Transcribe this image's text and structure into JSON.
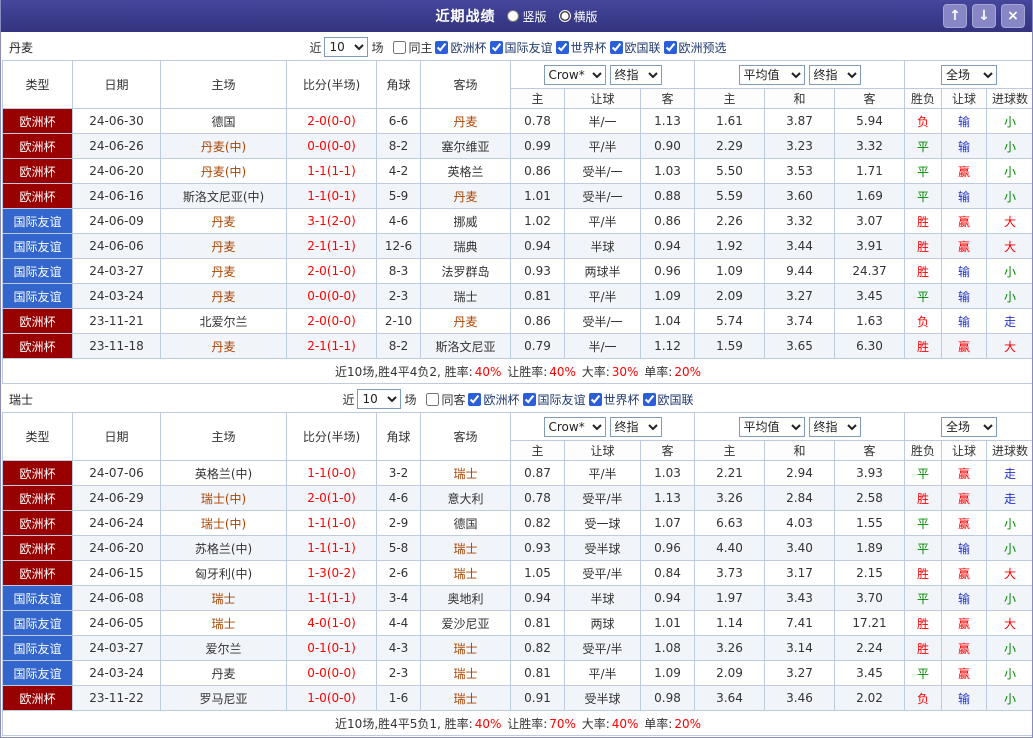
{
  "header": {
    "title": "近期战绩",
    "view_options": [
      {
        "label": "竖版",
        "selected": false
      },
      {
        "label": "横版",
        "selected": true
      }
    ],
    "window_buttons": {
      "up": "↑",
      "down": "↓",
      "close": "×"
    }
  },
  "table_header": {
    "type": "类型",
    "date": "日期",
    "home": "主场",
    "score": "比分(半场)",
    "corner": "角球",
    "away": "客场",
    "group1_selects": [
      "Crow*",
      "终指"
    ],
    "group2_selects": [
      "平均值",
      "终指"
    ],
    "group3_selects": [
      "全场"
    ],
    "sub": [
      "主",
      "让球",
      "客",
      "主",
      "和",
      "客",
      "胜负",
      "让球",
      "进球数"
    ]
  },
  "colors": {
    "competition": {
      "欧洲杯": "#990000",
      "国际友谊": "#3366cc"
    },
    "result": {
      "胜": "#ff0000",
      "平": "#008800",
      "负": "#ff0000",
      "赢": "#ff0000",
      "输": "#2233cc",
      "走": "#2233cc",
      "大": "#ff0000",
      "小": "#008800"
    },
    "focus_team": "#aa4400",
    "score": "#ff0000",
    "percent": "#ff0000"
  },
  "sections": [
    {
      "team": "丹麦",
      "filter": {
        "near_label": "近",
        "count": "10",
        "games_label": "场",
        "venue": {
          "label": "同主",
          "checked": false
        },
        "competitions": [
          {
            "label": "欧洲杯",
            "checked": true
          },
          {
            "label": "国际友谊",
            "checked": true
          },
          {
            "label": "世界杯",
            "checked": true
          },
          {
            "label": "欧国联",
            "checked": true
          },
          {
            "label": "欧洲预选",
            "checked": true
          }
        ]
      },
      "rows": [
        {
          "comp": "欧洲杯",
          "date": "24-06-30",
          "home": "德国",
          "score": "2-0(0-0)",
          "corner": "6-6",
          "away": "丹麦",
          "odds": [
            "0.78",
            "半/一",
            "1.13"
          ],
          "avg": [
            "1.61",
            "3.87",
            "5.94"
          ],
          "res": [
            "负",
            "输",
            "小"
          ]
        },
        {
          "comp": "欧洲杯",
          "date": "24-06-26",
          "home": "丹麦(中)",
          "score": "0-0(0-0)",
          "corner": "8-2",
          "away": "塞尔维亚",
          "odds": [
            "0.99",
            "平/半",
            "0.90"
          ],
          "avg": [
            "2.29",
            "3.23",
            "3.32"
          ],
          "res": [
            "平",
            "输",
            "小"
          ]
        },
        {
          "comp": "欧洲杯",
          "date": "24-06-20",
          "home": "丹麦(中)",
          "score": "1-1(1-1)",
          "corner": "4-2",
          "away": "英格兰",
          "odds": [
            "0.86",
            "受半/一",
            "1.03"
          ],
          "avg": [
            "5.50",
            "3.53",
            "1.71"
          ],
          "res": [
            "平",
            "赢",
            "小"
          ]
        },
        {
          "comp": "欧洲杯",
          "date": "24-06-16",
          "home": "斯洛文尼亚(中)",
          "score": "1-1(0-1)",
          "corner": "5-9",
          "away": "丹麦",
          "odds": [
            "1.01",
            "受半/一",
            "0.88"
          ],
          "avg": [
            "5.59",
            "3.60",
            "1.69"
          ],
          "res": [
            "平",
            "输",
            "小"
          ]
        },
        {
          "comp": "国际友谊",
          "date": "24-06-09",
          "home": "丹麦",
          "score": "3-1(2-0)",
          "corner": "4-6",
          "away": "挪威",
          "odds": [
            "1.02",
            "平/半",
            "0.86"
          ],
          "avg": [
            "2.26",
            "3.32",
            "3.07"
          ],
          "res": [
            "胜",
            "赢",
            "大"
          ]
        },
        {
          "comp": "国际友谊",
          "date": "24-06-06",
          "home": "丹麦",
          "score": "2-1(1-1)",
          "corner": "12-6",
          "away": "瑞典",
          "odds": [
            "0.94",
            "半球",
            "0.94"
          ],
          "avg": [
            "1.92",
            "3.44",
            "3.91"
          ],
          "res": [
            "胜",
            "赢",
            "大"
          ]
        },
        {
          "comp": "国际友谊",
          "date": "24-03-27",
          "home": "丹麦",
          "score": "2-0(1-0)",
          "corner": "8-3",
          "away": "法罗群岛",
          "odds": [
            "0.93",
            "两球半",
            "0.96"
          ],
          "avg": [
            "1.09",
            "9.44",
            "24.37"
          ],
          "res": [
            "胜",
            "输",
            "小"
          ]
        },
        {
          "comp": "国际友谊",
          "date": "24-03-24",
          "home": "丹麦",
          "score": "0-0(0-0)",
          "corner": "2-3",
          "away": "瑞士",
          "odds": [
            "0.81",
            "平/半",
            "1.09"
          ],
          "avg": [
            "2.09",
            "3.27",
            "3.45"
          ],
          "res": [
            "平",
            "输",
            "小"
          ]
        },
        {
          "comp": "欧洲杯",
          "date": "23-11-21",
          "home": "北爱尔兰",
          "score": "2-0(0-0)",
          "corner": "2-10",
          "away": "丹麦",
          "odds": [
            "0.86",
            "受半/一",
            "1.04"
          ],
          "avg": [
            "5.74",
            "3.74",
            "1.63"
          ],
          "res": [
            "负",
            "输",
            "走"
          ]
        },
        {
          "comp": "欧洲杯",
          "date": "23-11-18",
          "home": "丹麦",
          "score": "2-1(1-1)",
          "corner": "8-2",
          "away": "斯洛文尼亚",
          "odds": [
            "0.79",
            "半/一",
            "1.12"
          ],
          "avg": [
            "1.59",
            "3.65",
            "6.30"
          ],
          "res": [
            "胜",
            "赢",
            "大"
          ]
        }
      ],
      "summary": [
        [
          "近10场,胜4平4负2, 胜率:",
          0
        ],
        [
          "40%",
          1
        ],
        [
          " 让胜率:",
          0
        ],
        [
          "40%",
          1
        ],
        [
          " 大率:",
          0
        ],
        [
          "30%",
          1
        ],
        [
          " 单率:",
          0
        ],
        [
          "20%",
          1
        ]
      ]
    },
    {
      "team": "瑞士",
      "filter": {
        "near_label": "近",
        "count": "10",
        "games_label": "场",
        "venue": {
          "label": "同客",
          "checked": false
        },
        "competitions": [
          {
            "label": "欧洲杯",
            "checked": true
          },
          {
            "label": "国际友谊",
            "checked": true
          },
          {
            "label": "世界杯",
            "checked": true
          },
          {
            "label": "欧国联",
            "checked": true
          }
        ]
      },
      "rows": [
        {
          "comp": "欧洲杯",
          "date": "24-07-06",
          "home": "英格兰(中)",
          "score": "1-1(0-0)",
          "corner": "3-2",
          "away": "瑞士",
          "odds": [
            "0.87",
            "平/半",
            "1.03"
          ],
          "avg": [
            "2.21",
            "2.94",
            "3.93"
          ],
          "res": [
            "平",
            "赢",
            "走"
          ]
        },
        {
          "comp": "欧洲杯",
          "date": "24-06-29",
          "home": "瑞士(中)",
          "score": "2-0(1-0)",
          "corner": "4-6",
          "away": "意大利",
          "odds": [
            "0.78",
            "受平/半",
            "1.13"
          ],
          "avg": [
            "3.26",
            "2.84",
            "2.58"
          ],
          "res": [
            "胜",
            "赢",
            "走"
          ]
        },
        {
          "comp": "欧洲杯",
          "date": "24-06-24",
          "home": "瑞士(中)",
          "score": "1-1(1-0)",
          "corner": "2-9",
          "away": "德国",
          "odds": [
            "0.82",
            "受一球",
            "1.07"
          ],
          "avg": [
            "6.63",
            "4.03",
            "1.55"
          ],
          "res": [
            "平",
            "赢",
            "小"
          ]
        },
        {
          "comp": "欧洲杯",
          "date": "24-06-20",
          "home": "苏格兰(中)",
          "score": "1-1(1-1)",
          "corner": "5-8",
          "away": "瑞士",
          "odds": [
            "0.93",
            "受半球",
            "0.96"
          ],
          "avg": [
            "4.40",
            "3.40",
            "1.89"
          ],
          "res": [
            "平",
            "输",
            "小"
          ]
        },
        {
          "comp": "欧洲杯",
          "date": "24-06-15",
          "home": "匈牙利(中)",
          "score": "1-3(0-2)",
          "corner": "2-6",
          "away": "瑞士",
          "odds": [
            "1.05",
            "受平/半",
            "0.84"
          ],
          "avg": [
            "3.73",
            "3.17",
            "2.15"
          ],
          "res": [
            "胜",
            "赢",
            "大"
          ]
        },
        {
          "comp": "国际友谊",
          "date": "24-06-08",
          "home": "瑞士",
          "score": "1-1(1-1)",
          "corner": "3-4",
          "away": "奥地利",
          "odds": [
            "0.94",
            "半球",
            "0.94"
          ],
          "avg": [
            "1.97",
            "3.43",
            "3.70"
          ],
          "res": [
            "平",
            "输",
            "小"
          ]
        },
        {
          "comp": "国际友谊",
          "date": "24-06-05",
          "home": "瑞士",
          "score": "4-0(1-0)",
          "corner": "4-4",
          "away": "爱沙尼亚",
          "odds": [
            "0.81",
            "两球",
            "1.01"
          ],
          "avg": [
            "1.14",
            "7.41",
            "17.21"
          ],
          "res": [
            "胜",
            "赢",
            "大"
          ]
        },
        {
          "comp": "国际友谊",
          "date": "24-03-27",
          "home": "爱尔兰",
          "score": "0-1(0-1)",
          "corner": "4-3",
          "away": "瑞士",
          "odds": [
            "0.82",
            "受平/半",
            "1.08"
          ],
          "avg": [
            "3.26",
            "3.14",
            "2.24"
          ],
          "res": [
            "胜",
            "赢",
            "小"
          ]
        },
        {
          "comp": "国际友谊",
          "date": "24-03-24",
          "home": "丹麦",
          "score": "0-0(0-0)",
          "corner": "2-3",
          "away": "瑞士",
          "odds": [
            "0.81",
            "平/半",
            "1.09"
          ],
          "avg": [
            "2.09",
            "3.27",
            "3.45"
          ],
          "res": [
            "平",
            "赢",
            "小"
          ]
        },
        {
          "comp": "欧洲杯",
          "date": "23-11-22",
          "home": "罗马尼亚",
          "score": "1-0(0-0)",
          "corner": "1-6",
          "away": "瑞士",
          "odds": [
            "0.91",
            "受半球",
            "0.98"
          ],
          "avg": [
            "3.64",
            "3.46",
            "2.02"
          ],
          "res": [
            "负",
            "输",
            "小"
          ]
        }
      ],
      "summary": [
        [
          "近10场,胜4平5负1, 胜率:",
          0
        ],
        [
          "40%",
          1
        ],
        [
          " 让胜率:",
          0
        ],
        [
          "70%",
          1
        ],
        [
          " 大率:",
          0
        ],
        [
          "40%",
          1
        ],
        [
          " 单率:",
          0
        ],
        [
          "20%",
          1
        ]
      ]
    }
  ]
}
